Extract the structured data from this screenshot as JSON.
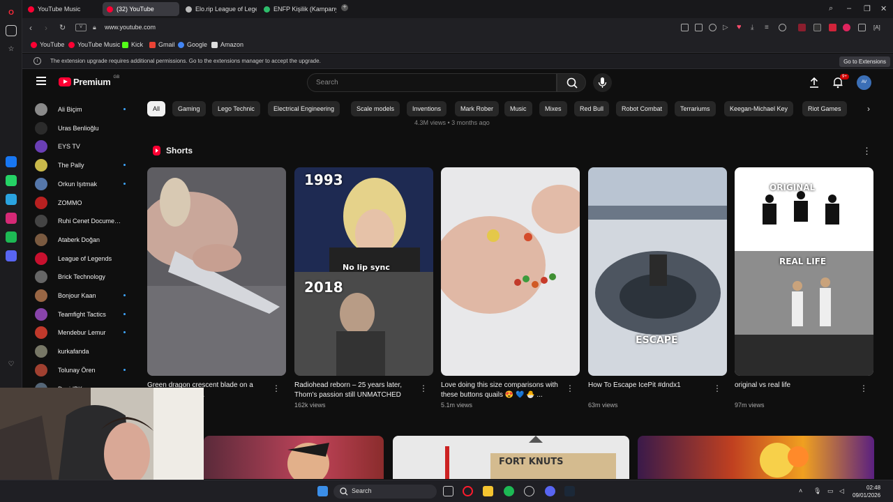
{
  "browser": {
    "tabs": [
      {
        "label": "YouTube Music",
        "favicon_color": "#ff0033"
      },
      {
        "label": "(32) YouTube",
        "favicon_color": "#ff0033"
      },
      {
        "label": "Elo.rip League of Legends",
        "favicon_color": "#bbbbbb"
      },
      {
        "label": "ENFP Kişilik (Kampanyacı)",
        "favicon_color": "#2ebd6b"
      }
    ],
    "new_tab_icon": "plus-icon",
    "url": "www.youtube.com",
    "bookmarks": [
      {
        "label": "YouTube",
        "color": "#ff0033"
      },
      {
        "label": "YouTube Music",
        "color": "#ff0033"
      },
      {
        "label": "Kick",
        "color": "#53fc18"
      },
      {
        "label": "Gmail",
        "color": "#ea4335"
      },
      {
        "label": "Google",
        "color": "#4285f4"
      },
      {
        "label": "Amazon",
        "color": "#dddddd"
      }
    ],
    "infobar_text": "The extension upgrade requires additional permissions. Go to the extensions manager to accept the upgrade.",
    "infobar_button": "Go to Extensions"
  },
  "youtube": {
    "logo_text": "Premium",
    "logo_sup": "GB",
    "search_placeholder": "Search",
    "notification_count": "9+",
    "avatar_label": "AV",
    "subscriptions": [
      {
        "name": "Ali Biçim",
        "color": "#8a8a8a",
        "live": true
      },
      {
        "name": "Uras Benlioğlu",
        "color": "#2b2b2b",
        "live": false
      },
      {
        "name": "EYS TV",
        "color": "#6a3fb5",
        "live": false
      },
      {
        "name": "The Pally",
        "color": "#c9b94a",
        "live": true
      },
      {
        "name": "Orkun Işıtmak",
        "color": "#5577aa",
        "live": true
      },
      {
        "name": "ZOMMO",
        "color": "#b82020",
        "live": false
      },
      {
        "name": "Ruhi Cenet Documentaries",
        "color": "#444444",
        "live": false
      },
      {
        "name": "Ataberk Doğan",
        "color": "#7a5a40",
        "live": false
      },
      {
        "name": "League of Legends",
        "color": "#c8102e",
        "live": false
      },
      {
        "name": "Brick Technology",
        "color": "#666666",
        "live": false
      },
      {
        "name": "Bonjour Kaan",
        "color": "#996644",
        "live": true
      },
      {
        "name": "Teamfight Tactics",
        "color": "#8844aa",
        "live": true
      },
      {
        "name": "Mendebur Lemur",
        "color": "#c0392b",
        "live": true
      },
      {
        "name": "kurkafanda",
        "color": "#777766",
        "live": false
      },
      {
        "name": "Tolunay Ören",
        "color": "#a04030",
        "live": true
      },
      {
        "name": "DavidBK",
        "color": "#556677",
        "live": false
      }
    ],
    "chips": [
      "All",
      "Gaming",
      "Lego Technic",
      "Electrical Engineering",
      "Scale models",
      "Inventions",
      "Mark Rober",
      "Music",
      "Mixes",
      "Red Bull",
      "Robot Combat",
      "Terrariums",
      "Keegan-Michael Key",
      "Riot Games"
    ],
    "previous_video_meta": "4.3M views • 3 months ago",
    "shorts_heading": "Shorts",
    "shorts": [
      {
        "title": "Green dragon crescent blade on a knife #satisfying ...",
        "views": "",
        "overlay": []
      },
      {
        "title": "Radiohead reborn – 25 years later, Thom's passion still UNMATCHED",
        "views": "162k views",
        "overlay": [
          "1993",
          "No lip sync",
          "2018"
        ]
      },
      {
        "title": "Love doing this size comparisons with these buttons quails 😍 💙 🐣 ...",
        "views": "5.1m views",
        "overlay": []
      },
      {
        "title": "How To Escape IcePit #dndx1",
        "views": "63m views",
        "overlay": [
          "ESCAPE"
        ]
      },
      {
        "title": "original vs real life",
        "views": "97m views",
        "overlay": [
          "ORIGINAL",
          "REAL LIFE"
        ]
      }
    ],
    "lower_thumb_text": "FORT KNUTS"
  },
  "taskbar": {
    "search_label": "Search",
    "time": "02:48",
    "date": "09/01/2026"
  }
}
